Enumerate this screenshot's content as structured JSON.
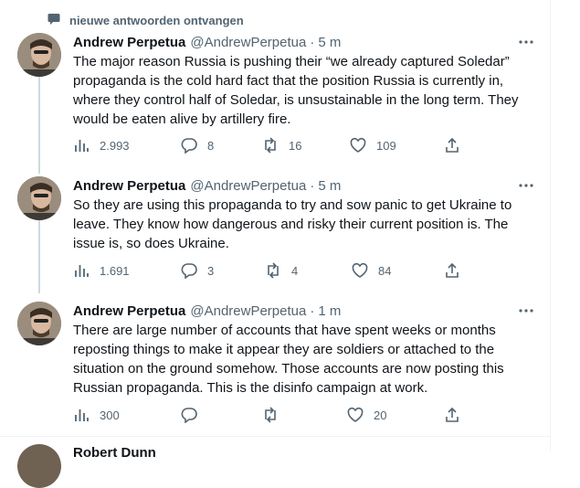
{
  "thread": {
    "notify_label": "nieuwe antwoorden ontvangen"
  },
  "colors": {
    "text_primary": "#0f1419",
    "text_secondary": "#536471",
    "thread_line": "#cfd9de",
    "divider": "#eff3f4"
  },
  "tweets": [
    {
      "name": "Andrew Perpetua",
      "handle": "@AndrewPerpetua",
      "separator": "·",
      "time": "5 m",
      "text": "The major reason Russia is pushing their “we already captured Soledar” propaganda is the cold hard fact that the position Russia is currently in, where they control half of Soledar, is unsustainable in the long term. They would be eaten alive by artillery fire.",
      "views": "2.993",
      "replies": "8",
      "retweets": "16",
      "likes": "109"
    },
    {
      "name": "Andrew Perpetua",
      "handle": "@AndrewPerpetua",
      "separator": "·",
      "time": "5 m",
      "text": "So they are using this propaganda to try and sow panic to get Ukraine to leave. They know how dangerous and risky their current position is. The issue is, so does Ukraine.",
      "views": "1.691",
      "replies": "3",
      "retweets": "4",
      "likes": "84"
    },
    {
      "name": "Andrew Perpetua",
      "handle": "@AndrewPerpetua",
      "separator": "·",
      "time": "1 m",
      "text": "There are large number of accounts that have spent weeks or months reposting things to make it appear they are soldiers or attached to the situation on the ground somehow. Those accounts are now posting this Russian propaganda. This is the disinfo campaign at work.",
      "views": "300",
      "replies": "",
      "retweets": "",
      "likes": "20"
    }
  ],
  "next_tweet": {
    "name": "Robert Dunn"
  }
}
